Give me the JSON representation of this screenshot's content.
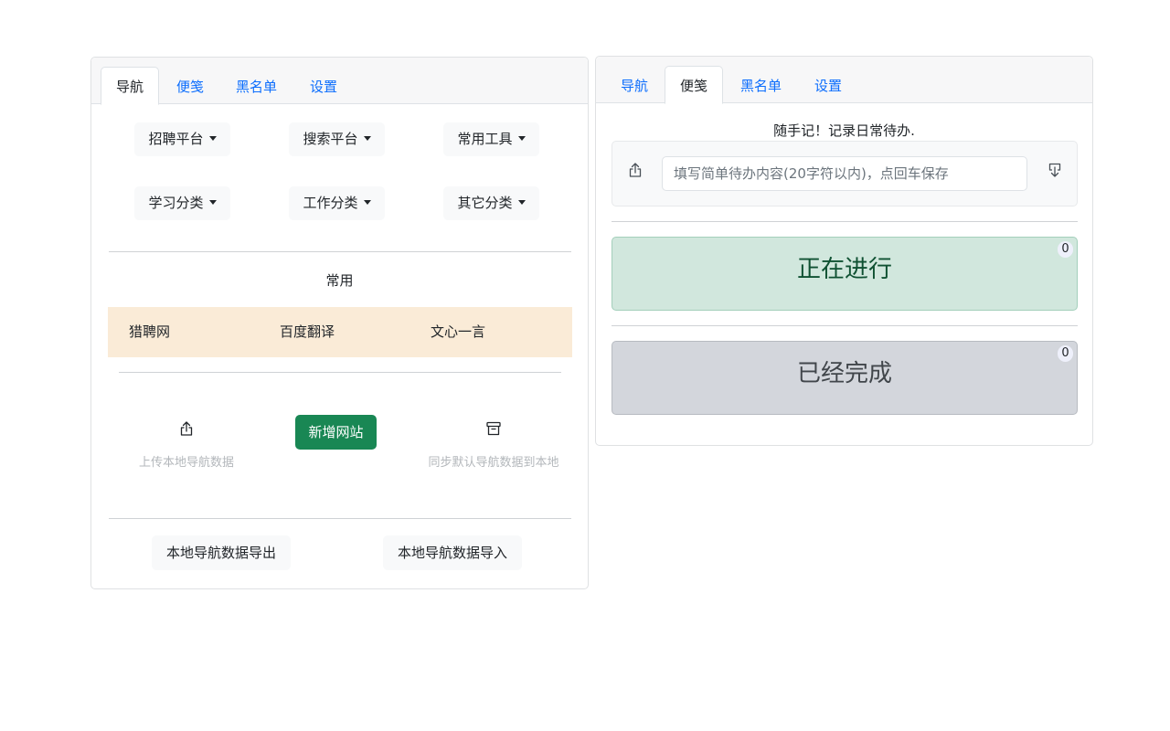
{
  "left": {
    "tabs": [
      {
        "label": "导航",
        "active": true
      },
      {
        "label": "便笺",
        "active": false
      },
      {
        "label": "黑名单",
        "active": false
      },
      {
        "label": "设置",
        "active": false
      }
    ],
    "categories": [
      "招聘平台",
      "搜索平台",
      "常用工具",
      "学习分类",
      "工作分类",
      "其它分类"
    ],
    "common_title": "常用",
    "common_links": [
      "猎聘网",
      "百度翻译",
      "文心一言"
    ],
    "upload_label": "上传本地导航数据",
    "add_site_label": "新增网站",
    "sync_label": "同步默认导航数据到本地",
    "export_label": "本地导航数据导出",
    "import_label": "本地导航数据导入",
    "icons": {
      "upload": "share-upload-icon",
      "sync": "archive-box-icon"
    }
  },
  "right": {
    "tabs": [
      {
        "label": "导航",
        "active": false
      },
      {
        "label": "便笺",
        "active": true
      },
      {
        "label": "黑名单",
        "active": false
      },
      {
        "label": "设置",
        "active": false
      }
    ],
    "note_title": "随手记！记录日常待办.",
    "input_value": "",
    "input_placeholder": "填写简单待办内容(20字符以内)，点回车保存",
    "in_progress_label": "正在进行",
    "in_progress_count": "0",
    "done_label": "已经完成",
    "done_count": "0",
    "colors": {
      "in_progress_bg": "#d1e7dd",
      "done_bg": "#d3d6dc",
      "accent": "#198754",
      "link": "#0d6efd"
    },
    "icons": {
      "upload": "share-upload-icon",
      "download": "download-icon"
    }
  }
}
